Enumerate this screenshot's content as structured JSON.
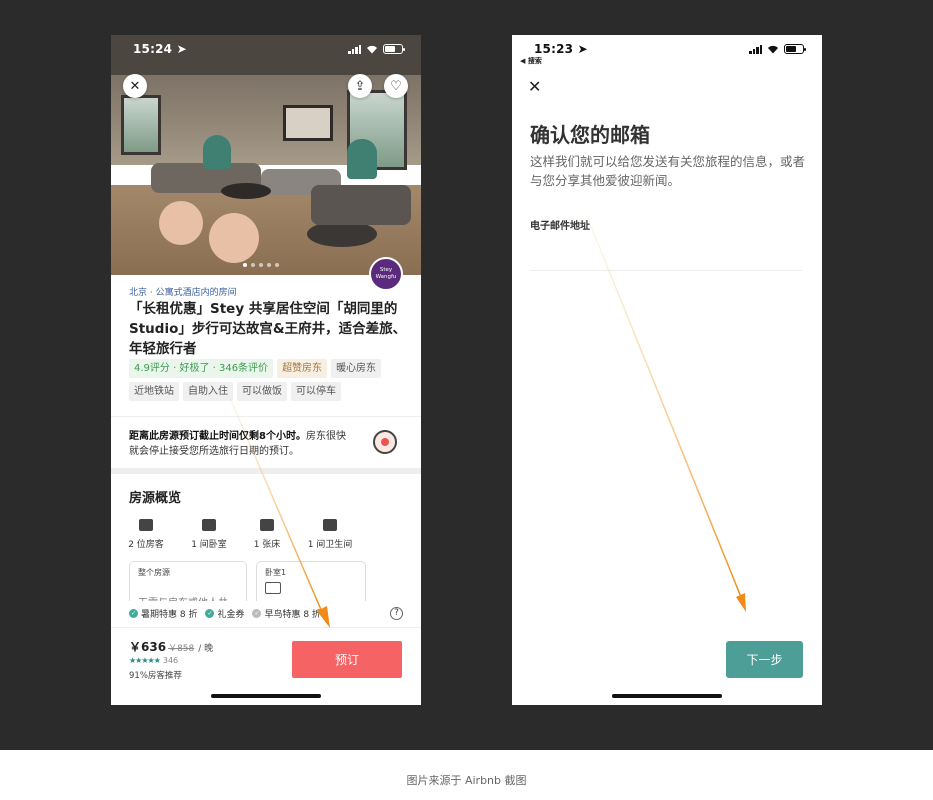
{
  "left_phone": {
    "status": {
      "time": "15:24 ➤"
    },
    "hero_buttons": {
      "close": "✕",
      "share": "⇪",
      "favorite": "♡"
    },
    "host_badge": {
      "line1": "Stey",
      "line2": "Wangfu"
    },
    "location": "北京 · 公寓式酒店内的房间",
    "title": "「长租优惠」Stey 共享居住空间「胡同里的Studio」步行可达故宫&王府井，适合差旅、年轻旅行者",
    "tags": [
      "4.9评分 · 好极了 · 346条评价",
      "超赞房东",
      "暖心房东",
      "近地铁站",
      "自助入住",
      "可以做饭",
      "可以停车"
    ],
    "notice_bold": "距离此房源预订截止时间仅剩8个小时。",
    "notice_rest": "房东很快就会停止接受您所选旅行日期的预订。",
    "overview_title": "房源概览",
    "amenities": [
      "2 位房客",
      "1 间卧室",
      "1 张床",
      "1 间卫生间"
    ],
    "room_cards": [
      {
        "label": "整个房源",
        "text": "无需与房东或他人共"
      },
      {
        "label": "卧室1",
        "text": ""
      }
    ],
    "promos": [
      "暑期特惠 8 折",
      "礼金券",
      "早鸟特惠 8 折"
    ],
    "help_icon": "?",
    "price": {
      "current": "￥636",
      "original": "￥858",
      "unit": "/ 晚"
    },
    "rating": {
      "stars": "★★★★★",
      "count": "346"
    },
    "recommend": "91%房客推荐",
    "book_label": "预订"
  },
  "right_phone": {
    "status": {
      "time": "15:23 ➤",
      "back": "◀ 搜索"
    },
    "close": "✕",
    "title": "确认您的邮箱",
    "subtitle": "这样我们就可以给您发送有关您旅程的信息，或者与您分享其他爱彼迎新闻。",
    "email_label": "电子邮件地址",
    "email_value": "",
    "next_label": "下一步"
  },
  "caption": "图片来源于 Airbnb 截图",
  "colors": {
    "book": "#f66364",
    "next": "#4e9e98",
    "arrow": "#f08a1a",
    "background": "#2b2b2b"
  }
}
